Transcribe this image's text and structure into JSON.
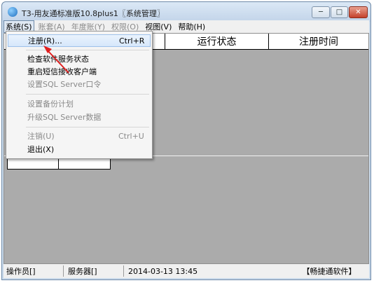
{
  "window": {
    "title": "T3-用友通标准版10.8plus1〖系统管理〗",
    "icon": "app-globe-icon",
    "controls": {
      "minimize": "─",
      "maximize": "□",
      "close": "✕"
    }
  },
  "menubar": {
    "items": [
      {
        "label": "系统(S)",
        "enabled": true,
        "active": true
      },
      {
        "label": "账套(A)",
        "enabled": false
      },
      {
        "label": "年度账(Y)",
        "enabled": false
      },
      {
        "label": "权限(O)",
        "enabled": false
      },
      {
        "label": "视图(V)",
        "enabled": true
      },
      {
        "label": "帮助(H)",
        "enabled": true
      }
    ]
  },
  "system_menu": {
    "items": [
      {
        "label": "注册(R)...",
        "shortcut": "Ctrl+R",
        "enabled": true,
        "highlighted": true
      },
      {
        "label": "检查软件服务状态",
        "enabled": true
      },
      {
        "label": "重启短信接收客户端",
        "enabled": true
      },
      {
        "label": "设置SQL Server口令",
        "enabled": false
      },
      {
        "label": "设置备份计划",
        "enabled": false
      },
      {
        "label": "升级SQL Server数据",
        "enabled": false
      },
      {
        "label": "注销(U)",
        "shortcut": "Ctrl+U",
        "enabled": false
      },
      {
        "label": "退出(X)",
        "enabled": true
      }
    ]
  },
  "grid": {
    "columns": [
      "",
      "",
      "",
      "运行状态",
      "注册时间"
    ]
  },
  "statusbar": {
    "operator": "操作员[]",
    "server": "服务器[]",
    "datetime": "2014-03-13 13:45",
    "brand": "【畅捷通软件】"
  },
  "annotation": {
    "arrow_color": "#e02020"
  }
}
